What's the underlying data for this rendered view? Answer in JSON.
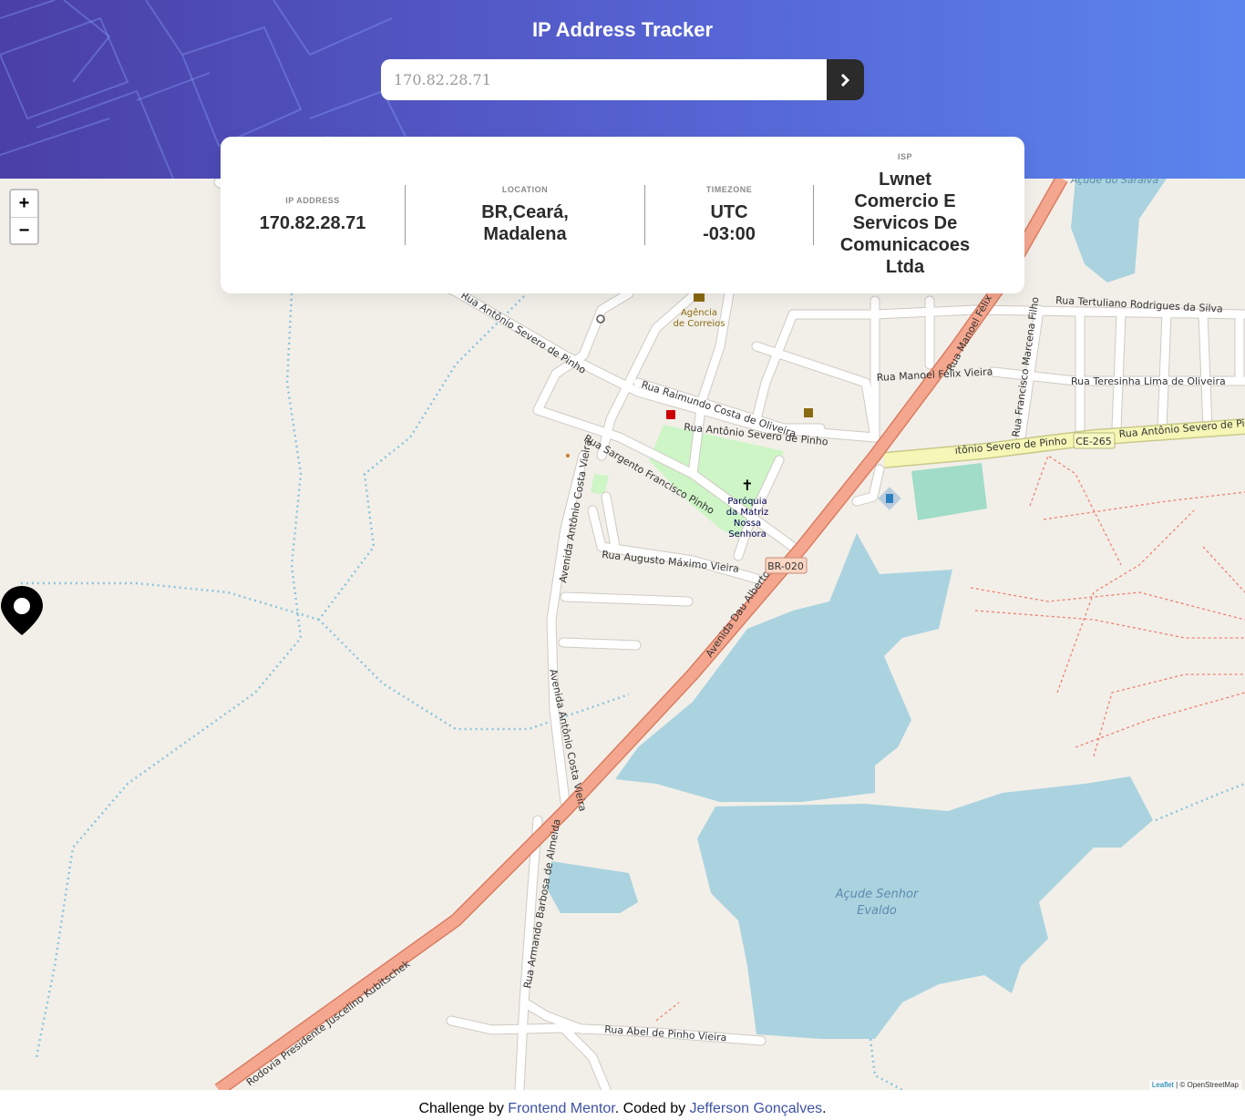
{
  "header": {
    "title": "IP Address Tracker",
    "search_value": "170.82.28.71"
  },
  "info": {
    "ip_label": "IP ADDRESS",
    "ip_value": "170.82.28.71",
    "location_label": "LOCATION",
    "location_line1": "BR,Ceará,",
    "location_line2": "Madalena",
    "timezone_label": "TIMEZONE",
    "timezone_line1": "UTC",
    "timezone_line2": "-03:00",
    "isp_label": "ISP",
    "isp_line1": "Lwnet",
    "isp_line2": "Comercio E",
    "isp_line3": "Servicos De",
    "isp_line4": "Comunicacoes",
    "isp_line5": "Ltda"
  },
  "map": {
    "zoom_in": "+",
    "zoom_out": "−",
    "attribution_leaflet": "Leaflet",
    "attribution_rest": " | © OpenStreetMap",
    "labels": {
      "saraiva": "Açude do Saraiva",
      "senhor_evaldo_1": "Açude Senhor",
      "senhor_evaldo_2": "Evaldo",
      "tertuliano": "Rua Tertuliano Rodrigues da Silva",
      "teresinha": "Rua Teresinha Lima de Oliveira",
      "manoel": "Rua Manoel Félix Vieira",
      "marcena": "Rua Francisco Marcena Filho",
      "antonio_severo_1": "Rua Antônio Severo de Pinho",
      "antonio_severo_2": "Rua Antônio Severo de Pinho",
      "antonio_severo_3": "Rua Antônio Severo de Pinho",
      "antonio_severo_4": "ıtônio Severo de Pinho",
      "raimundo": "Rua Raimundo Costa de Oliveira",
      "sargento": "Rua Sargento Francisco Pinho",
      "augusto": "Rua Augusto Máximo Vieira",
      "costa_vieira_1": "Avenida Antônio Costa Vieira",
      "costa_vieira_2": "Avenida Antônio Costa Vieira",
      "dau_alberto": "Avenida Dau Alberto",
      "juscelino": "Rodovia Presidente Juscelino Kubitschek",
      "armando": "Rua Armando Barbosa de Almeida",
      "abel": "Rua Abel de Pinho Vieira",
      "correios_1": "Agência",
      "correios_2": "de Correios",
      "paroquia_1": "Paróquia",
      "paroquia_2": "da Matriz",
      "paroquia_3": "Nossa",
      "paroquia_4": "Senhora",
      "br020": "BR-020",
      "ce265": "CE-265"
    }
  },
  "footer": {
    "prefix": "Challenge by ",
    "fm_link": "Frontend Mentor",
    "middle": ". Coded by ",
    "author_link": "Jefferson Gonçalves",
    "suffix": "."
  },
  "colors": {
    "header_start": "#4a3fa6",
    "header_end": "#5b85ee",
    "water": "#aad3df",
    "highway": "#f4a78e",
    "secondary_road": "#f6f7b7",
    "park": "#cdf5c6",
    "land": "#f2efe9"
  }
}
